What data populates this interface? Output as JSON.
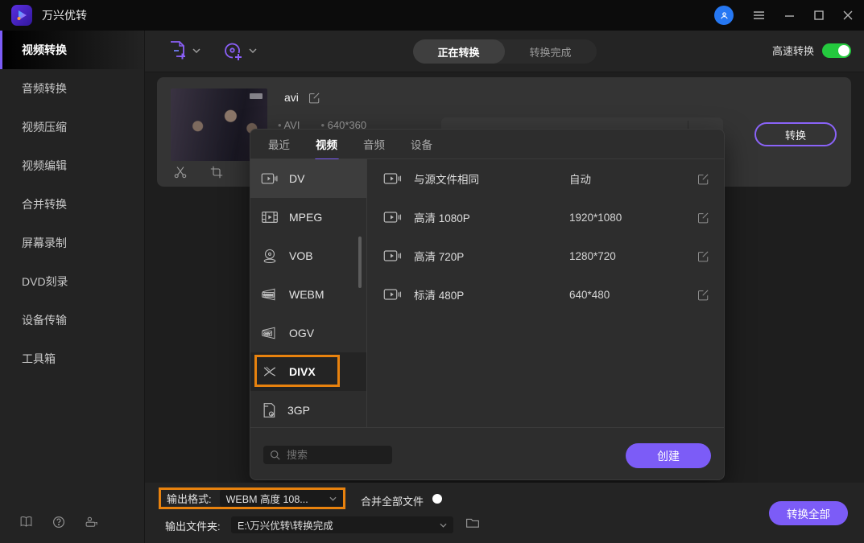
{
  "titlebar": {
    "app_title": "万兴优转",
    "icons": {
      "logo": "play-logo",
      "avatar": "user-avatar",
      "menu": "hamburger-icon",
      "minimize": "minimize-icon",
      "maximize": "maximize-icon",
      "close": "close-icon"
    }
  },
  "sidebar": {
    "items": [
      {
        "label": "视频转换",
        "active": true
      },
      {
        "label": "音频转换"
      },
      {
        "label": "视频压缩"
      },
      {
        "label": "视频编辑"
      },
      {
        "label": "合并转换"
      },
      {
        "label": "屏幕录制"
      },
      {
        "label": "DVD刻录"
      },
      {
        "label": "设备传输"
      },
      {
        "label": "工具箱"
      }
    ],
    "bottom_icons": [
      "guide-book-icon",
      "help-icon",
      "support-icon"
    ]
  },
  "toolbar": {
    "add_buttons": [
      "add-file-icon",
      "add-disc-icon"
    ],
    "tabs": [
      {
        "label": "正在转换",
        "active": true
      },
      {
        "label": "转换完成",
        "active": false
      }
    ],
    "fast_convert_label": "高速转换",
    "fast_convert_on": true
  },
  "file_card": {
    "name": "avi",
    "format": "AVI",
    "resolution": "640*360",
    "convert_label": "转换",
    "thumb_tools": [
      "trim-scissors-icon",
      "crop-icon"
    ]
  },
  "format_panel": {
    "tabs": [
      {
        "label": "最近",
        "active": false
      },
      {
        "label": "视频",
        "active": true
      },
      {
        "label": "音频",
        "active": false
      },
      {
        "label": "设备",
        "active": false
      }
    ],
    "formats": [
      {
        "label": "DV",
        "icon": "dv-camera-icon",
        "hover": true
      },
      {
        "label": "MPEG",
        "icon": "mpeg-film-icon"
      },
      {
        "label": "VOB",
        "icon": "dvd-disc-icon"
      },
      {
        "label": "WEBM",
        "icon": "webm-badge-icon"
      },
      {
        "label": "OGV",
        "icon": "ogv-badge-icon"
      },
      {
        "label": "DIVX",
        "icon": "divx-x-icon",
        "selected": true,
        "annotated": true
      },
      {
        "label": "3GP",
        "icon": "3gp-file-icon"
      }
    ],
    "presets": [
      {
        "name": "与源文件相同",
        "value": "自动"
      },
      {
        "name": "高清 1080P",
        "value": "1920*1080"
      },
      {
        "name": "高清 720P",
        "value": "1280*720"
      },
      {
        "name": "标清 480P",
        "value": "640*480"
      }
    ],
    "search_placeholder": "搜索",
    "create_label": "创建"
  },
  "bottom_bar": {
    "output_format_label": "输出格式:",
    "output_format_value": "WEBM 高度 108...",
    "merge_label": "合并全部文件",
    "merge_on": false,
    "output_folder_label": "输出文件夹:",
    "output_folder_value": "E:\\万兴优转\\转换完成",
    "convert_all_label": "转换全部"
  },
  "colors": {
    "accent_purple": "#7c5cf7",
    "toggle_green": "#24c93e",
    "annotation_orange": "#e8820e",
    "avatar_blue": "#2678f3"
  }
}
